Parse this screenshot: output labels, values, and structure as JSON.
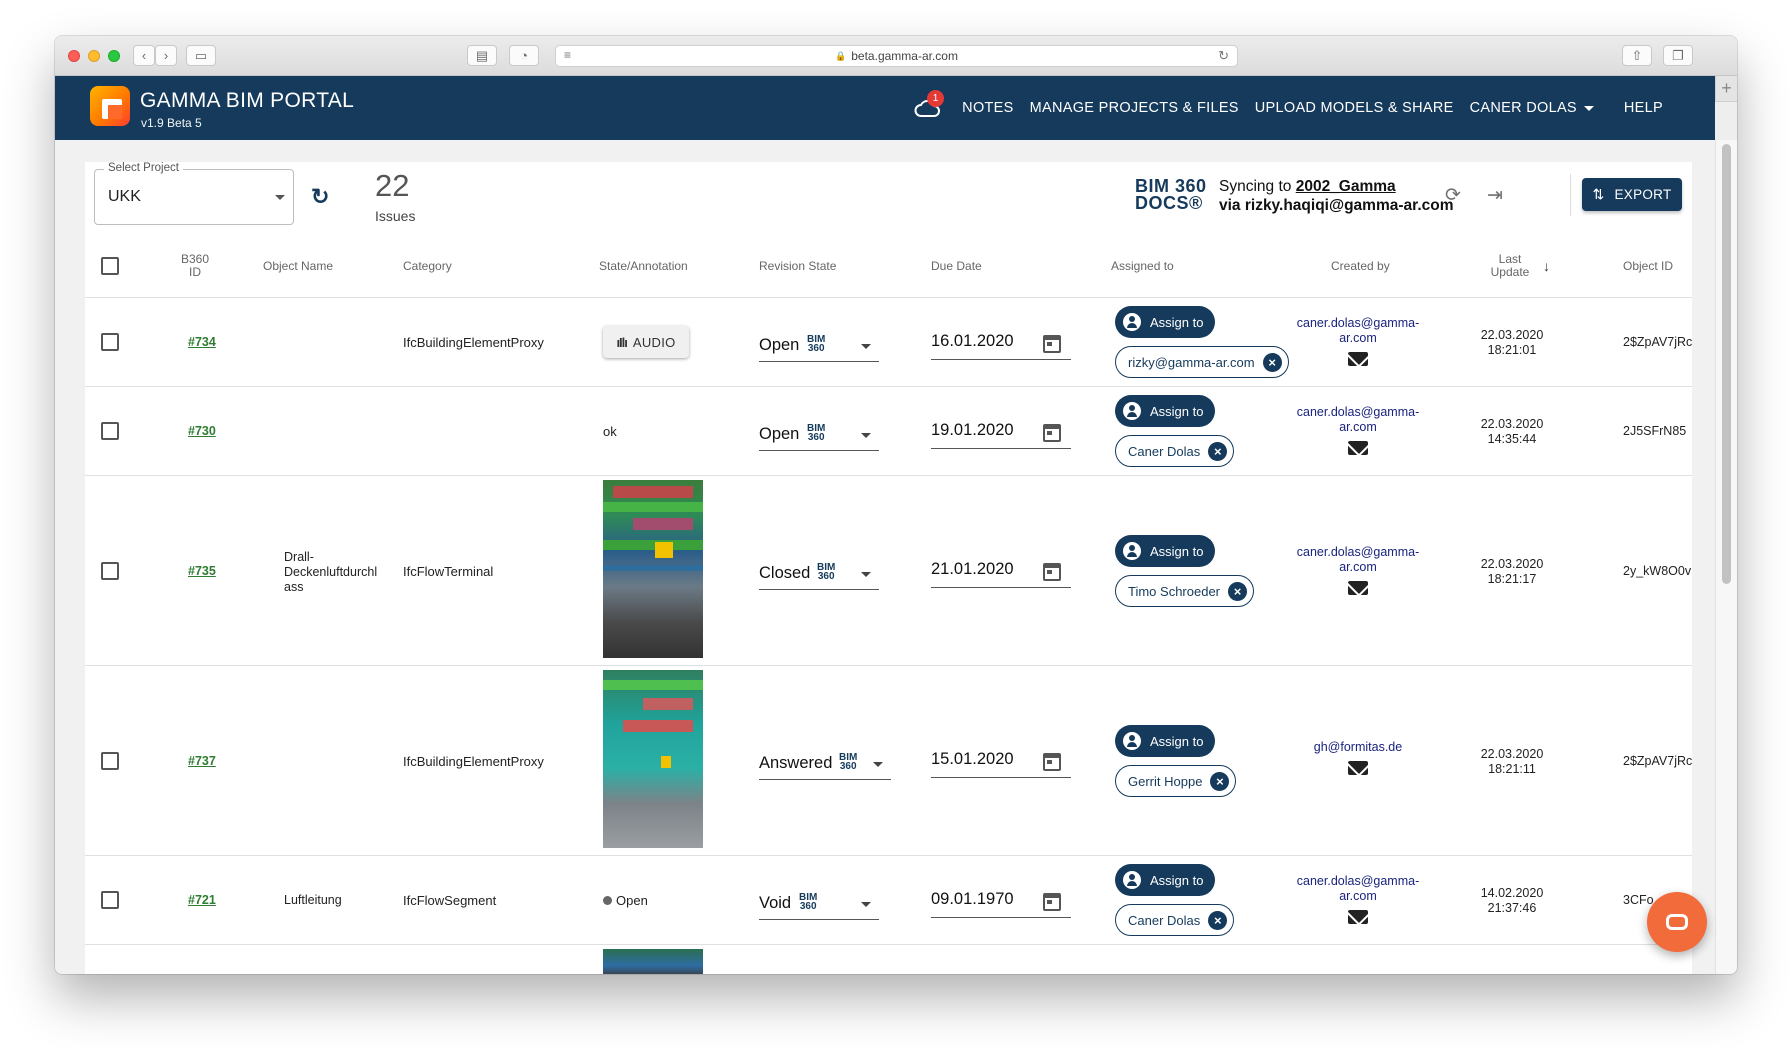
{
  "browser": {
    "url": "beta.gamma-ar.com"
  },
  "app": {
    "title": "GAMMA BIM PORTAL",
    "version": "v1.9 Beta 5",
    "notifications_count": "1",
    "nav": {
      "notes": "NOTES",
      "manage": "MANAGE PROJECTS & FILES",
      "upload": "UPLOAD MODELS & SHARE",
      "user": "CANER DOLAS",
      "help": "HELP"
    },
    "colors": {
      "header": "#153a5b",
      "accent_green": "#2e7d32",
      "chat": "#f26b3a"
    }
  },
  "toolbar": {
    "select_label": "Select Project",
    "select_value": "UKK",
    "issue_count": "22",
    "issue_label": "Issues",
    "bim_logo_line1": "BIM 360",
    "bim_logo_line2": "DOCS®",
    "sync_prefix": "Syncing to",
    "sync_project": "2002_Gamma",
    "sync_via": "via rizky.haqiqi@gamma-ar.com",
    "export_label": "EXPORT"
  },
  "table": {
    "headers": {
      "id": "B360\nID",
      "object_name": "Object Name",
      "category": "Category",
      "state": "State/Annotation",
      "revision": "Revision State",
      "due": "Due Date",
      "assigned": "Assigned to",
      "created": "Created by",
      "last_update": "Last\nUpdate",
      "object_id": "Object ID"
    },
    "assign_label": "Assign to",
    "bim_tag": "BIM\n360",
    "audio_label": "AUDIO",
    "rows": [
      {
        "id": "#734",
        "object_name": "",
        "category": "IfcBuildingElementProxy",
        "state_type": "audio",
        "state_text": "",
        "revision": "Open",
        "due": "16.01.2020",
        "assignee": "rizky@gamma-ar.com",
        "created_line1": "caner.dolas@gamma-",
        "created_line2": "ar.com",
        "update_date": "22.03.2020",
        "update_time": "18:21:01",
        "object_id": "2$ZpAV7jRc"
      },
      {
        "id": "#730",
        "object_name": "",
        "category": "",
        "state_type": "text",
        "state_text": "ok",
        "revision": "Open",
        "due": "19.01.2020",
        "assignee": "Caner Dolas",
        "created_line1": "caner.dolas@gamma-",
        "created_line2": "ar.com",
        "update_date": "22.03.2020",
        "update_time": "14:35:44",
        "object_id": "2J5SFrN85"
      },
      {
        "id": "#735",
        "object_name": "Drall-\nDeckenluftdurchl\nass",
        "category": "IfcFlowTerminal",
        "state_type": "image",
        "state_text": "",
        "revision": "Closed",
        "due": "21.01.2020",
        "assignee": "Timo Schroeder",
        "created_line1": "caner.dolas@gamma-",
        "created_line2": "ar.com",
        "update_date": "22.03.2020",
        "update_time": "18:21:17",
        "object_id": "2y_kW8O0v"
      },
      {
        "id": "#737",
        "object_name": "",
        "category": "IfcBuildingElementProxy",
        "state_type": "image",
        "state_text": "",
        "revision": "Answered",
        "due": "15.01.2020",
        "assignee": "Gerrit Hoppe",
        "created_line1": "gh@formitas.de",
        "created_line2": "",
        "update_date": "22.03.2020",
        "update_time": "18:21:11",
        "object_id": "2$ZpAV7jRc"
      },
      {
        "id": "#721",
        "object_name": "Luftleitung",
        "category": "IfcFlowSegment",
        "state_type": "status",
        "state_text": "Open",
        "revision": "Void",
        "due": "09.01.1970",
        "assignee": "Caner Dolas",
        "created_line1": "caner.dolas@gamma-",
        "created_line2": "ar.com",
        "update_date": "14.02.2020",
        "update_time": "21:37:46",
        "object_id": "3CFo"
      }
    ]
  }
}
